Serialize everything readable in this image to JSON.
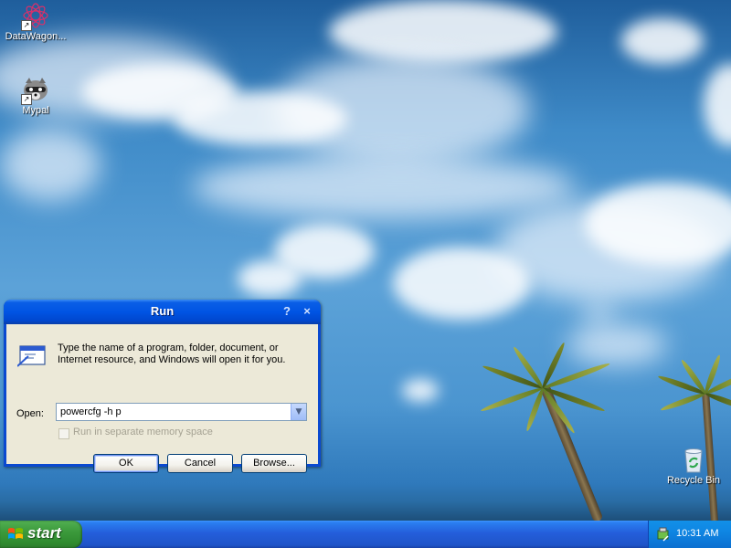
{
  "desktop": {
    "icons": [
      {
        "label": "DataWagon..."
      },
      {
        "label": "Mypal"
      },
      {
        "label": "Recycle Bin"
      }
    ]
  },
  "run_dialog": {
    "title": "Run",
    "help_glyph": "?",
    "close_glyph": "×",
    "description_line1": "Type the name of a program, folder, document, or",
    "description_line2": "Internet resource, and Windows will open it for you.",
    "open_label": "Open:",
    "open_value": "powercfg -h p",
    "separate_memory_label": "Run in separate memory space",
    "separate_memory_enabled": false,
    "ok_label": "OK",
    "cancel_label": "Cancel",
    "browse_label": "Browse..."
  },
  "taskbar": {
    "start_label": "start",
    "clock": "10:31 AM"
  }
}
